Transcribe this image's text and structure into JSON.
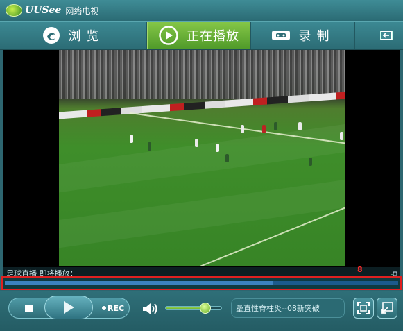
{
  "app": {
    "logo_text": "UUSee",
    "logo_cn": "网络电视"
  },
  "nav": {
    "browse": "浏览",
    "now_playing": "正在播放",
    "record": "录制"
  },
  "video": {
    "status_text": "足球直播  即将播放：",
    "marker_label": "8",
    "progress": 0.68
  },
  "controls": {
    "rec_label": "REC",
    "volume": 0.7,
    "channel_text": "曐直性脊柱炎--08新突破"
  },
  "colors": {
    "accent_green": "#5fa82a",
    "frame_red": "#e02020",
    "progress_blue": "#1c5a8c"
  }
}
